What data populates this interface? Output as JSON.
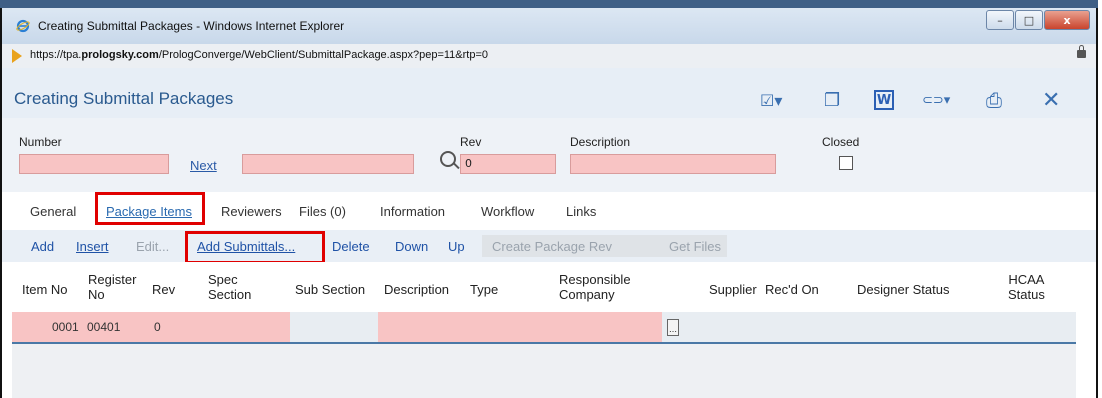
{
  "window": {
    "title": "Creating Submittal Packages - Windows Internet Explorer",
    "controls": {
      "minimize": "–",
      "maximize": "□",
      "close": "x"
    }
  },
  "address": {
    "url_prefix": "https://tpa.",
    "url_domain": "prologsky.com",
    "url_path": "/PrologConverge/WebClient/SubmittalPackage.aspx?pep=11&rtp=0"
  },
  "app": {
    "title": "Creating Submittal Packages",
    "toolbar": {
      "checkout": "☑▾",
      "copy": "❐",
      "word": "W",
      "link": "⊂⊃▾",
      "print": "⎙",
      "close": "✕"
    }
  },
  "form": {
    "number_label": "Number",
    "next_label": "Next",
    "rev_label": "Rev",
    "rev_value": "0",
    "description_label": "Description",
    "closed_label": "Closed"
  },
  "tabs": [
    "General",
    "Package Items",
    "Reviewers",
    "Files (0)",
    "Information",
    "Workflow",
    "Links"
  ],
  "actions": {
    "add": "Add",
    "insert": "Insert",
    "edit": "Edit...",
    "add_submittals": "Add Submittals...",
    "delete": "Delete",
    "down": "Down",
    "up": "Up",
    "create_package_rev": "Create Package Rev",
    "get_files": "Get Files"
  },
  "grid": {
    "columns": [
      {
        "l1": "Item No",
        "l2": ""
      },
      {
        "l1": "Register",
        "l2": "No"
      },
      {
        "l1": "Rev",
        "l2": ""
      },
      {
        "l1": "Spec",
        "l2": "Section"
      },
      {
        "l1": "Sub Section",
        "l2": ""
      },
      {
        "l1": "Description",
        "l2": ""
      },
      {
        "l1": "Type",
        "l2": ""
      },
      {
        "l1": "Responsible",
        "l2": "Company"
      },
      {
        "l1": "Supplier",
        "l2": ""
      },
      {
        "l1": "Rec'd On",
        "l2": ""
      },
      {
        "l1": "Designer Status",
        "l2": ""
      },
      {
        "l1": "HCAA",
        "l2": "Status"
      }
    ],
    "rows": [
      {
        "item_no": "0001",
        "register_no": "00401",
        "rev": "0"
      }
    ]
  },
  "colors": {
    "required_field": "#f8c4c4",
    "highlight": "#e00000",
    "link": "#1f52a6"
  }
}
